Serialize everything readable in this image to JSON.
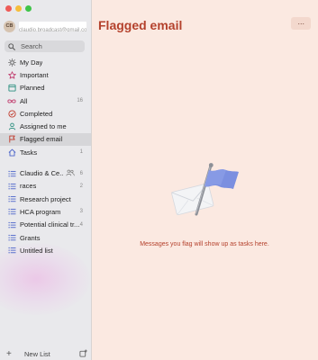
{
  "account": {
    "initials": "CB",
    "email": "claudio.broadcast@gmail.com"
  },
  "search": {
    "label": "Search"
  },
  "smart_lists": [
    {
      "label": "My Day",
      "icon": "sun-icon",
      "count": ""
    },
    {
      "label": "Important",
      "icon": "star-icon",
      "count": ""
    },
    {
      "label": "Planned",
      "icon": "calendar-icon",
      "count": ""
    },
    {
      "label": "All",
      "icon": "infinity-icon",
      "count": "16"
    },
    {
      "label": "Completed",
      "icon": "check-circle-icon",
      "count": ""
    },
    {
      "label": "Assigned to me",
      "icon": "person-icon",
      "count": ""
    },
    {
      "label": "Flagged email",
      "icon": "flag-icon",
      "count": ""
    },
    {
      "label": "Tasks",
      "icon": "home-icon",
      "count": "1"
    }
  ],
  "user_lists": [
    {
      "label": "Claudio & Ce...",
      "count": "6",
      "shared": true
    },
    {
      "label": "races",
      "count": "2"
    },
    {
      "label": "Research project",
      "count": ""
    },
    {
      "label": "HCA program",
      "count": "3"
    },
    {
      "label": "Potential clinical tr...",
      "count": "4"
    },
    {
      "label": "Grants",
      "count": ""
    },
    {
      "label": "Untitled list",
      "count": ""
    }
  ],
  "footer": {
    "new_list_label": "New List"
  },
  "main": {
    "title": "Flagged email",
    "more_label": "···",
    "empty_message": "Messages you flag will show up as tasks here."
  },
  "colors": {
    "accent": "#b4412c",
    "background": "#fbe9e1",
    "sidebar": "#e9e9ec",
    "selected": "#d6d6d9",
    "flag": "#7b8fe0"
  }
}
